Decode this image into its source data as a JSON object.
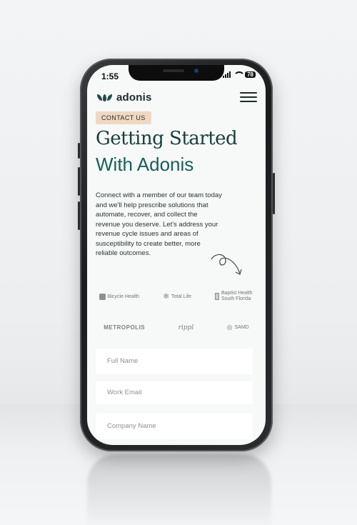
{
  "status_bar": {
    "time": "1:55",
    "battery": "78"
  },
  "brand": {
    "name": "adonis",
    "color": "#1f4a47"
  },
  "nav": {
    "menu_icon": "hamburger-menu-icon"
  },
  "hero": {
    "badge": "CONTACT US",
    "title_line1": "Getting Started",
    "title_line2": "With Adonis",
    "intro": "Connect with a member of our team today and we'll help prescribe solutions that automate, recover, and collect the revenue you deserve.  Let's address your revenue cycle issues and areas of susceptibility to create better, more reliable outcomes."
  },
  "partners": {
    "row1": [
      "Bicycle Health",
      "Total Life",
      "Baptist Health South Florida"
    ],
    "row2": [
      "METROPOLIS",
      "rippl",
      "SAMD"
    ]
  },
  "form": {
    "full_name_placeholder": "Full Name",
    "work_email_placeholder": "Work Email",
    "company_name_placeholder": "Company Name"
  }
}
